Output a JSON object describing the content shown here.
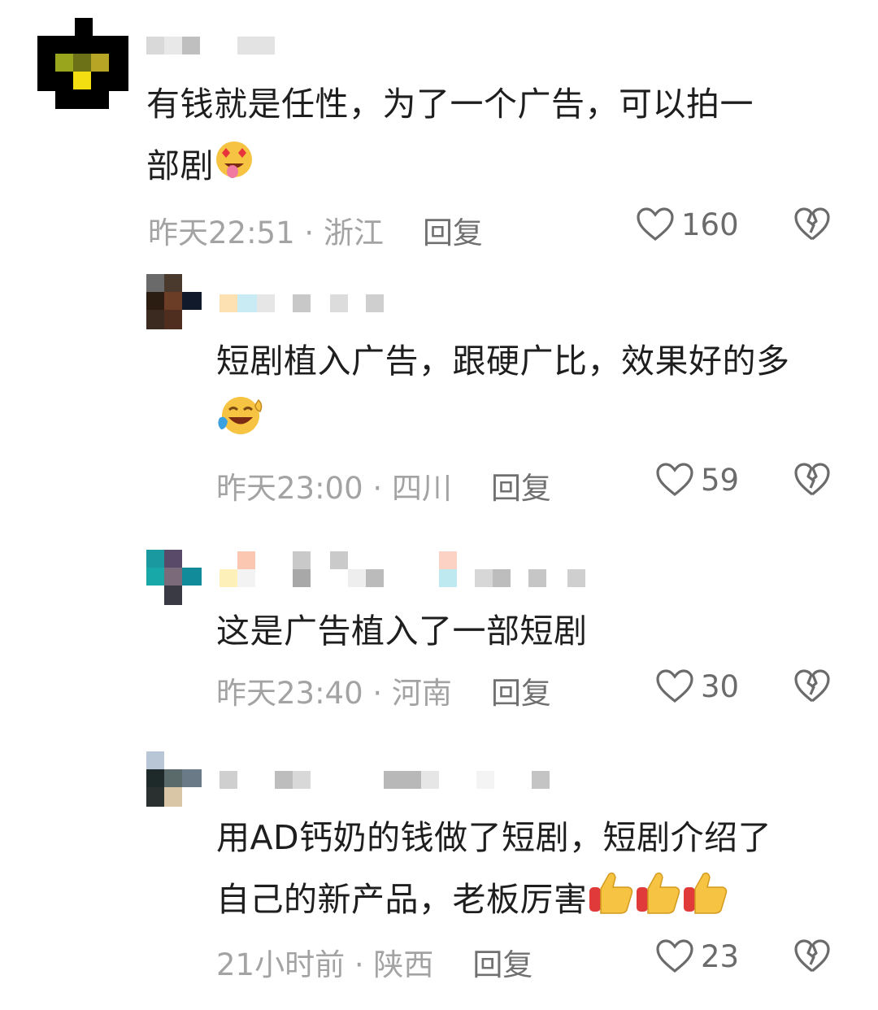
{
  "comments": [
    {
      "text_line1": "有钱就是任性，为了一个广告，可以拍一",
      "text_line2": "部剧",
      "emojis": [
        "heart-eyes-tongue-emoji"
      ],
      "time": "昨天22:51",
      "location": "浙江",
      "reply_label": "回复",
      "likes": "160"
    },
    {
      "text_line1": "短剧植入广告，跟硬广比，效果好的多",
      "text_line2": "",
      "emojis": [
        "laughing-tears-emoji"
      ],
      "time": "昨天23:00",
      "location": "四川",
      "reply_label": "回复",
      "likes": "59"
    },
    {
      "text_line1": "这是广告植入了一部短剧",
      "text_line2": "",
      "emojis": [],
      "time": "昨天23:40",
      "location": "河南",
      "reply_label": "回复",
      "likes": "30"
    },
    {
      "text_line1": "用AD钙奶的钱做了短剧，短剧介绍了",
      "text_line2": "自己的新产品，老板厉害",
      "emojis": [
        "thumbs-up-emoji",
        "thumbs-up-emoji",
        "thumbs-up-emoji"
      ],
      "time": "21小时前",
      "location": "陕西",
      "reply_label": "回复",
      "likes": "23"
    }
  ],
  "separator": " · ",
  "colors": {
    "text": "#1e1e1e",
    "meta": "#a3a3a3",
    "reply": "#707070",
    "icon": "#6b6b6b"
  },
  "icons": {
    "like": "heart-outline-icon",
    "dislike": "broken-heart-icon"
  }
}
